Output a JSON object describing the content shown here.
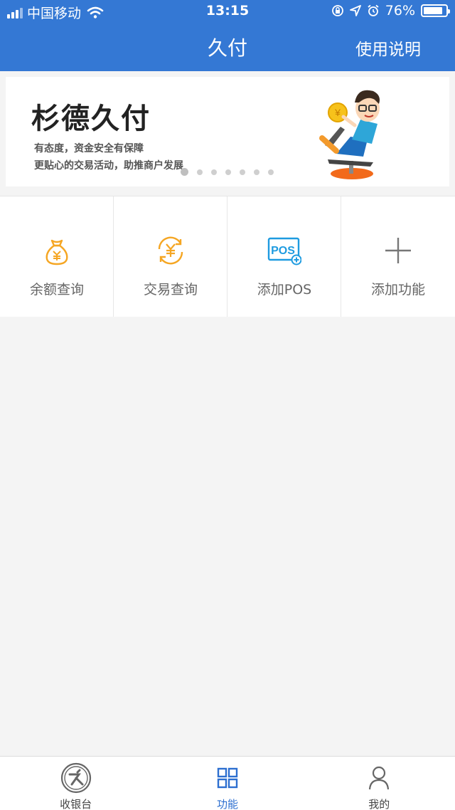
{
  "status_bar": {
    "carrier": "中国移动",
    "time": "13:15",
    "battery_text": "76%",
    "battery_level": 0.76
  },
  "nav": {
    "title": "久付",
    "right_link": "使用说明"
  },
  "banner": {
    "title": "杉德久付",
    "subtitle_1": "有态度，资金安全有保障",
    "subtitle_2": "更贴心的交易活动，助推商户发展",
    "page_count": 7,
    "active_page": 1
  },
  "functions": [
    {
      "label": "余额查询",
      "icon": "money-bag-icon"
    },
    {
      "label": "交易查询",
      "icon": "yuan-refresh-icon"
    },
    {
      "label": "添加POS",
      "icon": "pos-add-icon",
      "icon_text": "POS"
    },
    {
      "label": "添加功能",
      "icon": "plus-icon"
    }
  ],
  "tabbar": [
    {
      "label": "收银台",
      "icon": "cashier-logo-icon"
    },
    {
      "label": "功能",
      "icon": "grid-icon",
      "active": true
    },
    {
      "label": "我的",
      "icon": "person-icon"
    }
  ],
  "colors": {
    "primary": "#3478d4",
    "accent_orange": "#f5a623",
    "pos_blue": "#1e9be0",
    "active_tab": "#2d6fd0"
  }
}
